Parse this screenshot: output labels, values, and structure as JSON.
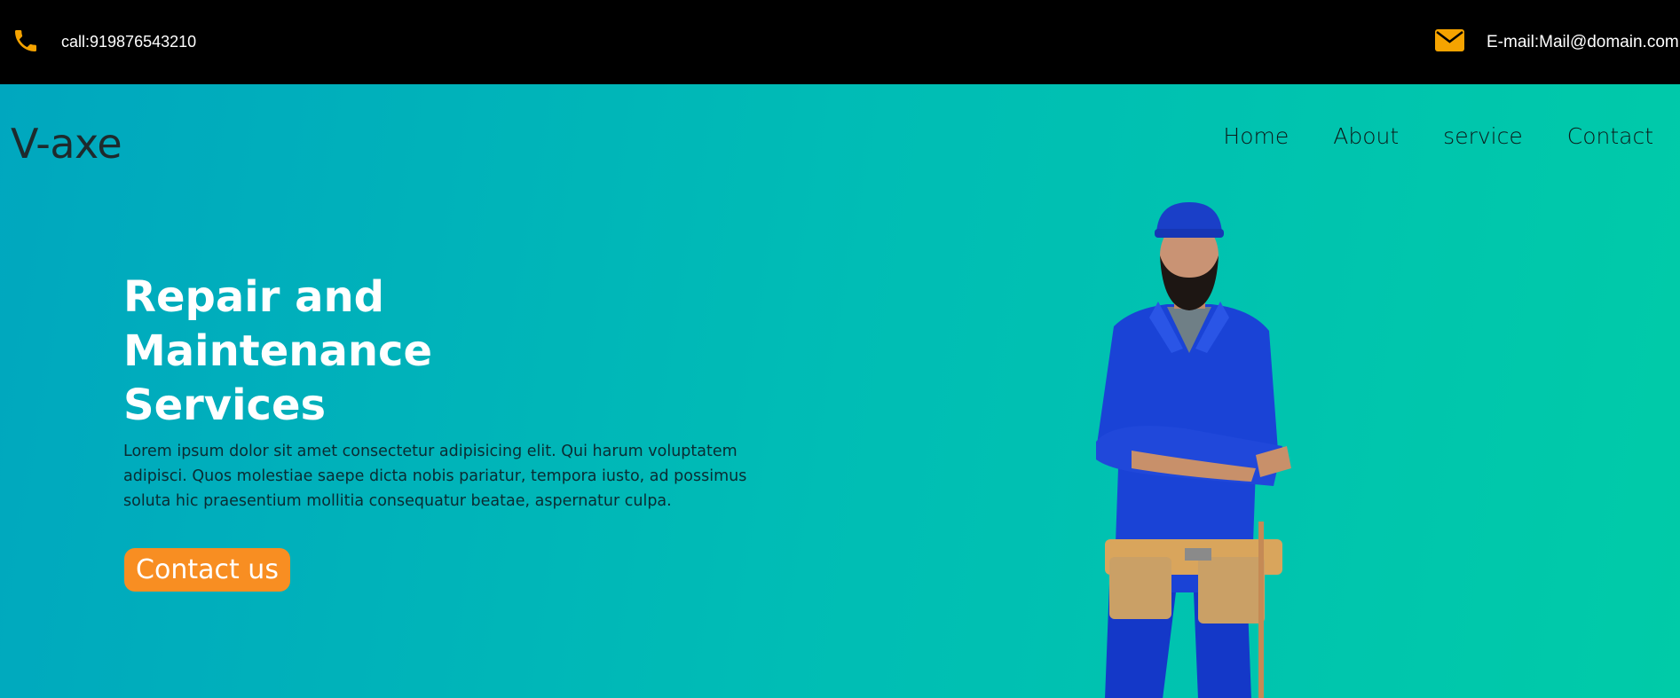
{
  "topbar": {
    "phone_icon": "phone-icon",
    "phone_text": "call:919876543210",
    "mail_icon": "envelope-icon",
    "email_text": "E-mail:Mail@domain.com",
    "icon_color": "#f5a300"
  },
  "header": {
    "logo": "V-axe",
    "nav": [
      "Home",
      "About",
      "service",
      "Contact"
    ]
  },
  "hero": {
    "heading_lines": [
      "Repair and",
      "Maintenance",
      "Services"
    ],
    "description": "Lorem ipsum dolor sit amet consectetur adipisicing elit. Qui harum voluptatem adipisci. Quos molestiae saepe dicta nobis pariatur, tempora iusto, ad possimus soluta hic praesentium mollitia consequatur beatae, aspernatur culpa.",
    "cta_label": "Contact us",
    "cta_color": "#f88e22",
    "image": "worker-in-blue-overalls-with-tool-belt"
  }
}
